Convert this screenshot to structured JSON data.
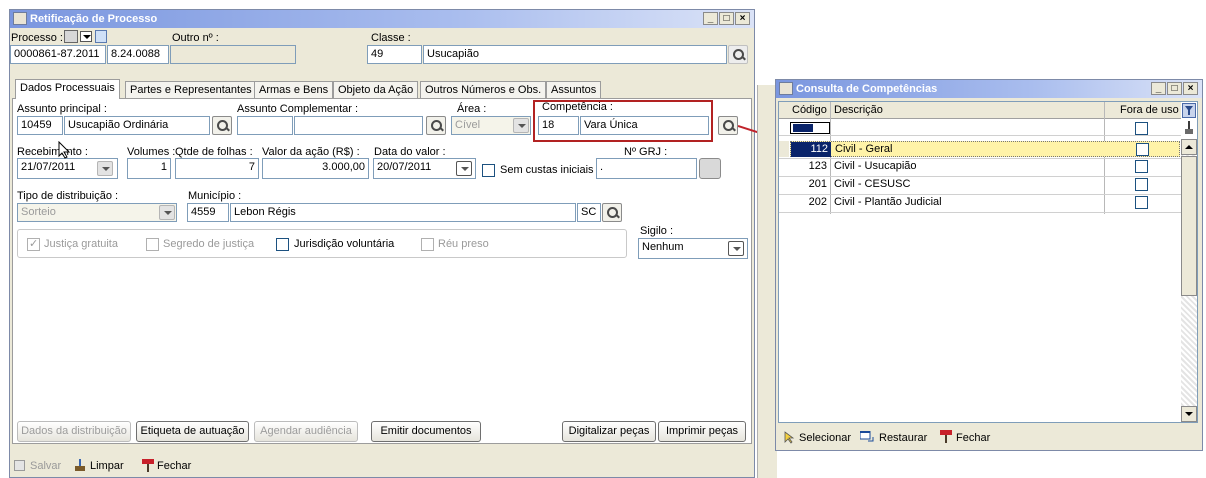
{
  "main_window": {
    "title": "Retificação de Processo",
    "processo_label": "Processo :",
    "outro_label": "Outro nº :",
    "classe_label": "Classe :",
    "processo_value": "0000861-87.2011",
    "processo_suffix": "8.24.0088",
    "classe_code": "49",
    "classe_name": "Usucapião",
    "tabs": [
      {
        "label": "Dados Processuais"
      },
      {
        "label": "Partes e Representantes"
      },
      {
        "label": "Armas e Bens"
      },
      {
        "label": "Objeto da Ação"
      },
      {
        "label": "Outros Números e Obs."
      },
      {
        "label": "Assuntos"
      }
    ],
    "assunto_principal_label": "Assunto principal :",
    "assunto_principal_code": "10459",
    "assunto_principal_name": "Usucapião Ordinária",
    "assunto_complementar_label": "Assunto Complementar :",
    "area_label": "Área :",
    "area_value": "Cível",
    "competencia_label": "Competência :",
    "competencia_code": "18",
    "competencia_name": "Vara Única",
    "recebimento_label": "Recebimento :",
    "recebimento_value": "21/07/2011",
    "volumes_label": "Volumes :",
    "volumes_value": "1",
    "qtde_folhas_label": "Qtde de folhas :",
    "qtde_folhas_value": "7",
    "valor_acao_label": "Valor da ação (R$) :",
    "valor_acao_value": "3.000,00",
    "data_valor_label": "Data do valor :",
    "data_valor_value": "20/07/2011",
    "sem_custas_label": "Sem custas iniciais",
    "grj_label": "Nº GRJ :",
    "grj_value": ".",
    "tipo_distribuicao_label": "Tipo de distribuição :",
    "tipo_distribuicao_value": "Sorteio",
    "municipio_label": "Município :",
    "municipio_code": "4559",
    "municipio_name": "Lebon Régis",
    "municipio_uf": "SC",
    "sigilo_label": "Sigilo :",
    "sigilo_value": "Nenhum",
    "justica_gratuita": "Justiça gratuita",
    "segredo_justica": "Segredo de justiça",
    "jurisdicao_voluntaria": "Jurisdição voluntária",
    "reu_preso": "Réu preso",
    "buttons": {
      "dados_distribuicao": "Dados da distribuição",
      "etiqueta": "Etiqueta de autuação",
      "agendar": "Agendar audiência",
      "emitir": "Emitir documentos",
      "digitalizar": "Digitalizar peças",
      "imprimir": "Imprimir peças"
    },
    "footer": {
      "salvar": "Salvar",
      "limpar": "Limpar",
      "fechar": "Fechar"
    }
  },
  "consulta_window": {
    "title": "Consulta de Competências",
    "columns": {
      "codigo": "Código",
      "descricao": "Descrição",
      "fora_uso": "Fora de uso"
    },
    "rows": [
      {
        "codigo": "112",
        "descricao": "Civil - Geral"
      },
      {
        "codigo": "123",
        "descricao": "Civil - Usucapião"
      },
      {
        "codigo": "201",
        "descricao": "Civil - CESUSC"
      },
      {
        "codigo": "202",
        "descricao": "Civil - Plantão Judicial"
      }
    ],
    "footer": {
      "selecionar": "Selecionar",
      "restaurar": "Restaurar",
      "fechar": "Fechar"
    }
  },
  "colors": {
    "highlight_border": "#b22222",
    "selected_row": "#fff3a8",
    "title_gradient": "#7a96df"
  }
}
